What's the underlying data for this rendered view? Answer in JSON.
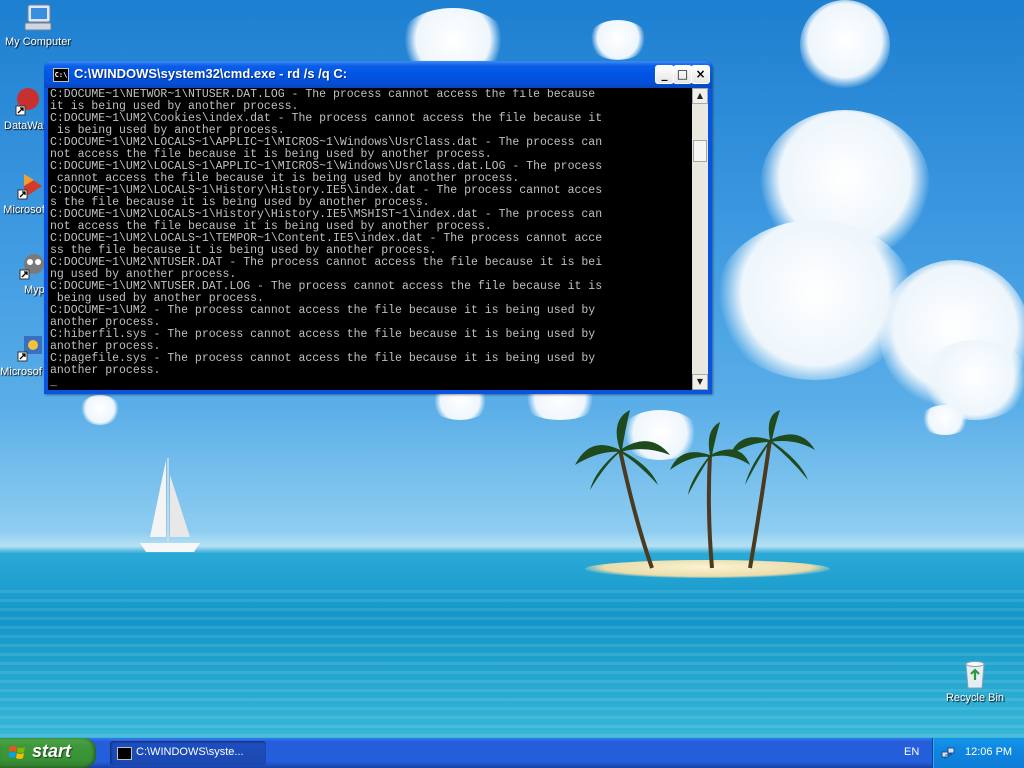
{
  "desktop": {
    "icons": [
      {
        "label": "My Computer"
      },
      {
        "label": "DataWa"
      },
      {
        "label": "Microsof C++"
      },
      {
        "label": "Myp"
      },
      {
        "label": "Microsof Basic"
      }
    ],
    "recycle_bin": {
      "label": "Recycle Bin",
      "icon": "recycle-bin-icon"
    }
  },
  "window": {
    "title": "C:\\WINDOWS\\system32\\cmd.exe - rd /s /q C:",
    "buttons": {
      "minimize": "_",
      "maximize": "□",
      "close": "×"
    },
    "console_lines": [
      "C:DOCUME~1\\NETWOR~1\\NTUSER.DAT.LOG - The process cannot access the file because",
      "it is being used by another process.",
      "C:DOCUME~1\\UM2\\Cookies\\index.dat - The process cannot access the file because it",
      " is being used by another process.",
      "C:DOCUME~1\\UM2\\LOCALS~1\\APPLIC~1\\MICROS~1\\Windows\\UsrClass.dat - The process can",
      "not access the file because it is being used by another process.",
      "C:DOCUME~1\\UM2\\LOCALS~1\\APPLIC~1\\MICROS~1\\Windows\\UsrClass.dat.LOG - The process",
      " cannot access the file because it is being used by another process.",
      "C:DOCUME~1\\UM2\\LOCALS~1\\History\\History.IE5\\index.dat - The process cannot acces",
      "s the file because it is being used by another process.",
      "C:DOCUME~1\\UM2\\LOCALS~1\\History\\History.IE5\\MSHIST~1\\index.dat - The process can",
      "not access the file because it is being used by another process.",
      "C:DOCUME~1\\UM2\\LOCALS~1\\TEMPOR~1\\Content.IE5\\index.dat - The process cannot acce",
      "ss the file because it is being used by another process.",
      "C:DOCUME~1\\UM2\\NTUSER.DAT - The process cannot access the file because it is bei",
      "ng used by another process.",
      "C:DOCUME~1\\UM2\\NTUSER.DAT.LOG - The process cannot access the file because it is",
      " being used by another process.",
      "C:DOCUME~1\\UM2 - The process cannot access the file because it is being used by",
      "another process.",
      "C:hiberfil.sys - The process cannot access the file because it is being used by",
      "another process.",
      "C:pagefile.sys - The process cannot access the file because it is being used by",
      "another process.",
      "_"
    ]
  },
  "taskbar": {
    "start_label": "start",
    "task_label": "C:\\WINDOWS\\syste...",
    "language": "EN",
    "clock": "12:06 PM"
  }
}
